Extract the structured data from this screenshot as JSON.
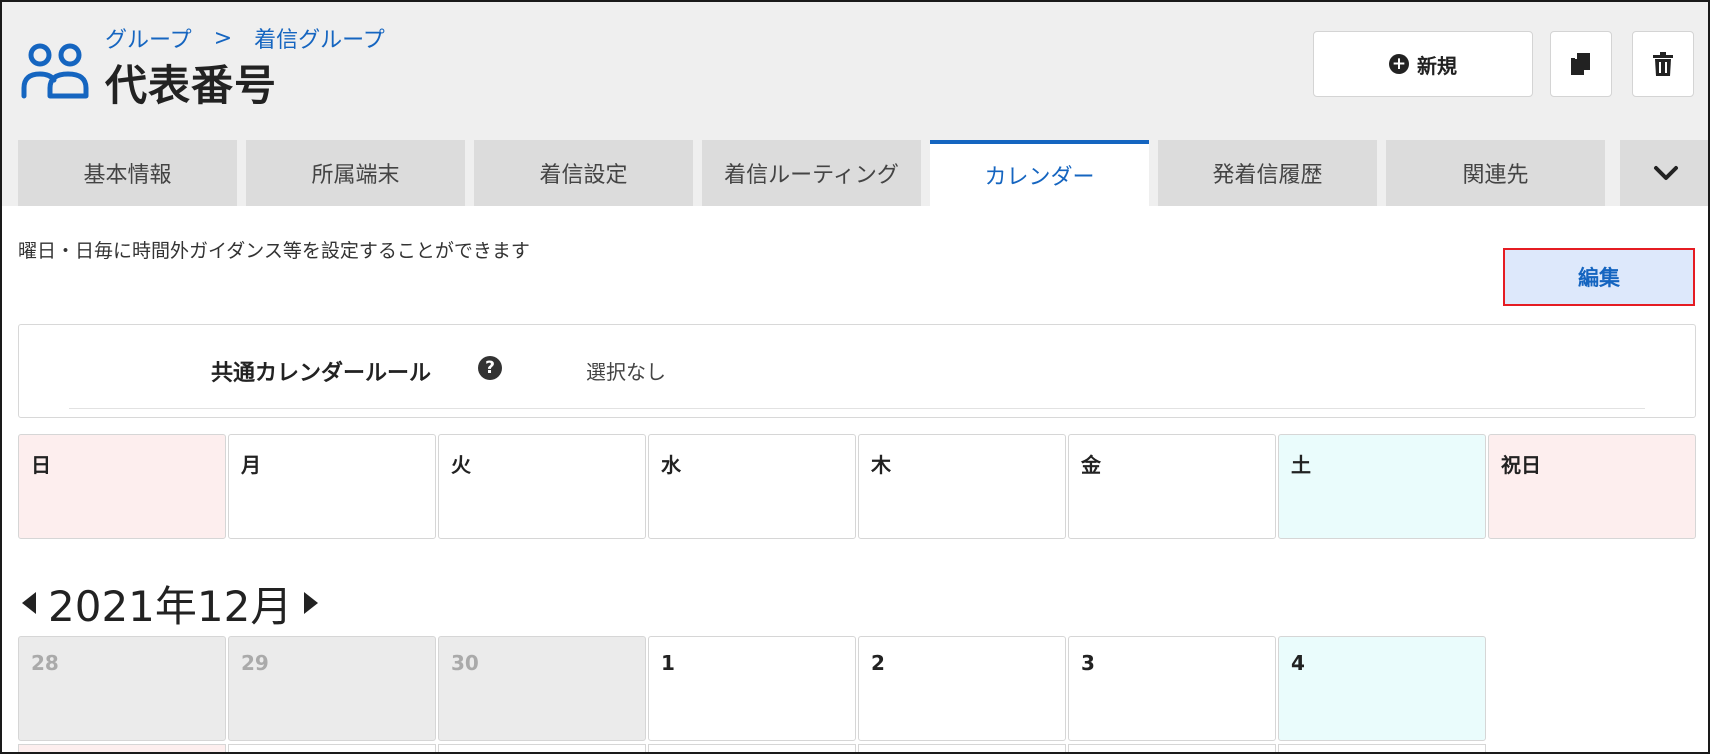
{
  "breadcrumb": {
    "parent": "グループ",
    "separator": ">",
    "current": "着信グループ"
  },
  "page_title": "代表番号",
  "actions": {
    "new_label": "新規",
    "copy_icon": "copy-icon",
    "delete_icon": "trash-icon"
  },
  "tabs": [
    {
      "label": "基本情報",
      "active": false
    },
    {
      "label": "所属端末",
      "active": false
    },
    {
      "label": "着信設定",
      "active": false
    },
    {
      "label": "着信ルーティング",
      "active": false
    },
    {
      "label": "カレンダー",
      "active": true
    },
    {
      "label": "発着信履歴",
      "active": false
    },
    {
      "label": "関連先",
      "active": false
    }
  ],
  "content": {
    "description": "曜日・日毎に時間外ガイダンス等を設定することができます",
    "edit_label": "編集",
    "common_rule": {
      "label": "共通カレンダールール",
      "value": "選択なし"
    }
  },
  "weekdays": [
    "日",
    "月",
    "火",
    "水",
    "木",
    "金",
    "土",
    "祝日"
  ],
  "calendar": {
    "month_label": "2021年12月",
    "first_week": [
      "28",
      "29",
      "30",
      "1",
      "2",
      "3",
      "4"
    ]
  },
  "colors": {
    "accent": "#1565c0",
    "sunday_bg": "#fdeeee",
    "saturday_bg": "#eafcfc",
    "highlight_border": "#e51c23"
  }
}
